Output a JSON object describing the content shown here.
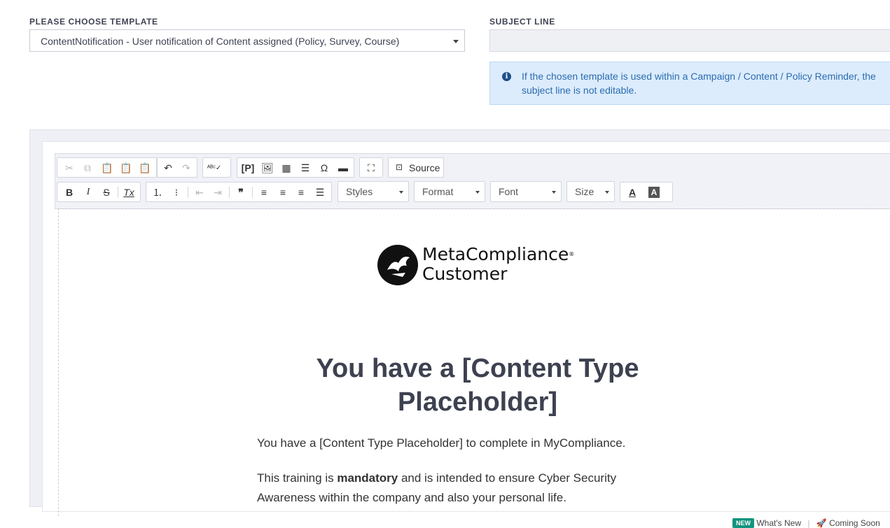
{
  "template": {
    "label": "PLEASE CHOOSE TEMPLATE",
    "selected": "ContentNotification - User notification of Content assigned (Policy, Survey, Course)"
  },
  "subject": {
    "label": "SUBJECT LINE",
    "value": "",
    "info": "If the chosen template is used within a Campaign / Content / Policy Reminder, the subject line is not editable."
  },
  "editor": {
    "toolbar": {
      "row1": [
        "cut-icon",
        "copy-icon",
        "paste-icon",
        "paste-text-icon",
        "paste-word-icon",
        "undo-icon",
        "redo-icon",
        "spellcheck-icon",
        "placeholder-icon",
        "image-icon",
        "table-icon",
        "horizontal-line-icon",
        "special-char-icon",
        "iframe-icon",
        "maximize-icon"
      ],
      "source_label": "Source",
      "styles_label": "Styles",
      "format_label": "Format",
      "font_label": "Font",
      "size_label": "Size"
    },
    "body": {
      "logo_line1": "MetaCompliance",
      "logo_line2": "Customer",
      "reg": "®",
      "heading": "You have a [Content Type Placeholder]",
      "para1": "You have a [Content Type Placeholder] to complete in MyCompliance.",
      "para2_prefix": "This training is ",
      "para2_bold": "mandatory",
      "para2_suffix": " and is intended to ensure Cyber Security Awareness within the company and also your personal life."
    }
  },
  "footer": {
    "new_badge": "NEW",
    "whats_new": "What's New",
    "coming_soon": "Coming Soon"
  }
}
